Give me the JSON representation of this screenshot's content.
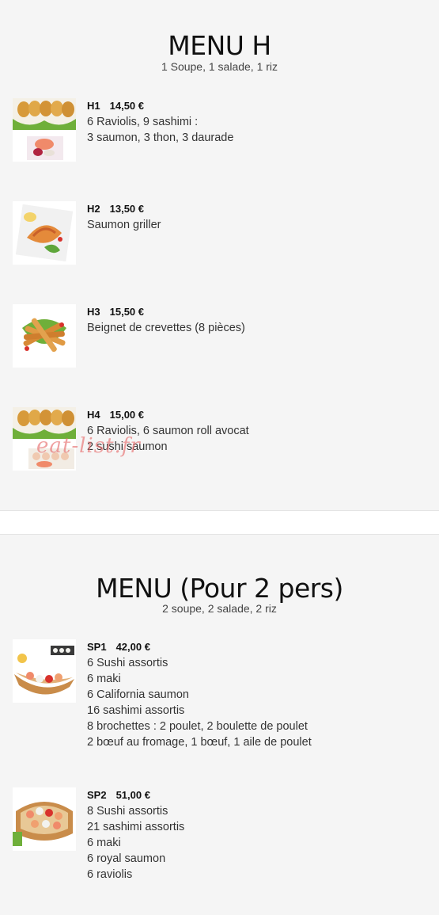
{
  "menu_h": {
    "title": "MENU H",
    "subtitle": "1 Soupe, 1 salade, 1 riz",
    "items": [
      {
        "code": "H1",
        "price": "14,50 €",
        "lines": [
          "6 Raviolis, 9 sashimi :",
          "3 saumon, 3 thon, 3 daurade"
        ]
      },
      {
        "code": "H2",
        "price": "13,50 €",
        "lines": [
          "Saumon griller"
        ]
      },
      {
        "code": "H3",
        "price": "15,50 €",
        "lines": [
          "Beignet de crevettes (8 pièces)"
        ]
      },
      {
        "code": "H4",
        "price": "15,00 €",
        "lines": [
          "6 Raviolis, 6 saumon roll avocat",
          "2 sushi saumon"
        ]
      }
    ]
  },
  "menu_2": {
    "title": "MENU (Pour 2 pers)",
    "subtitle": "2 soupe, 2 salade, 2 riz",
    "items": [
      {
        "code": "SP1",
        "price": "42,00 €",
        "lines": [
          "6 Sushi assortis",
          "6 maki",
          "6 California saumon",
          "16 sashimi assortis",
          "8 brochettes : 2 poulet, 2 boulette de poulet",
          "2 bœuf au fromage, 1 bœuf, 1 aile de poulet"
        ]
      },
      {
        "code": "SP2",
        "price": "51,00 €",
        "lines": [
          "8 Sushi assortis",
          "21 sashimi assortis",
          "6 maki",
          "6 royal saumon",
          "6 raviolis"
        ]
      }
    ]
  },
  "watermark": "eat-list.fr"
}
